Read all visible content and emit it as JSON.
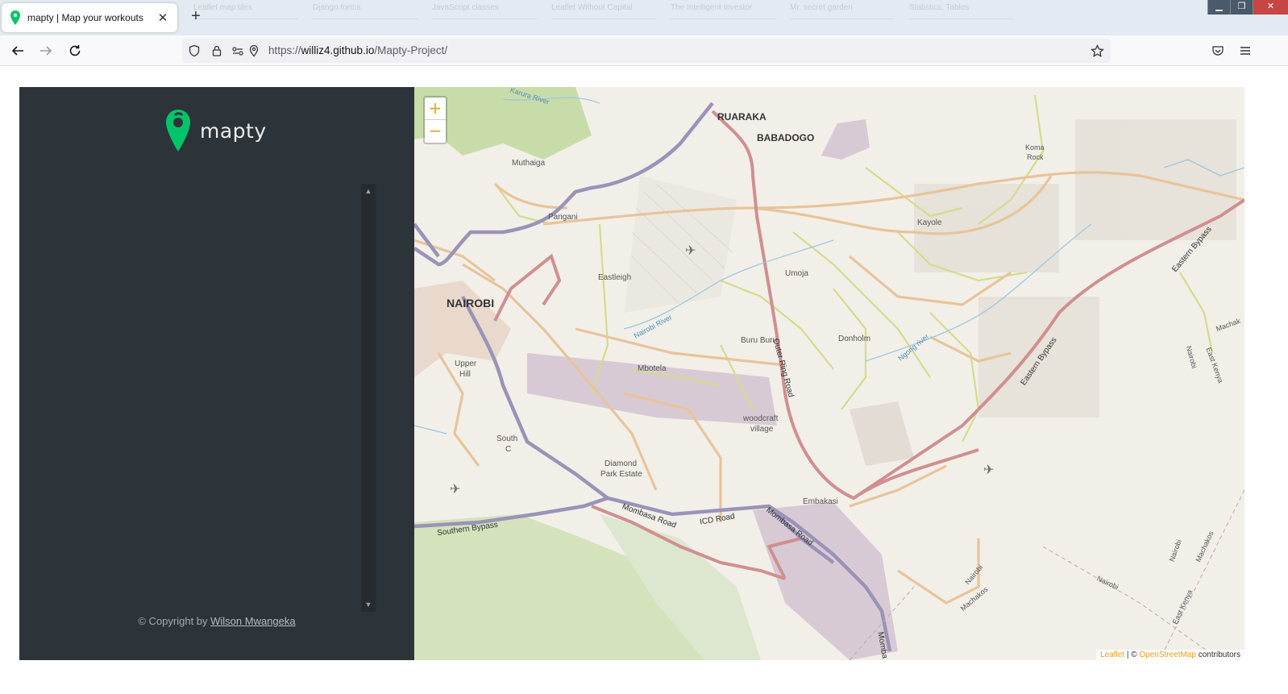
{
  "browser": {
    "tab_title": "mapty | Map your workouts",
    "tab_close": "✕",
    "new_tab": "+",
    "url_scheme": "https://",
    "url_host": "williz4.github.io",
    "url_path": "/Mapty-Project/",
    "background_tabs": [
      "Leaflet map tiles",
      "Django forms",
      "JavaScript classes",
      "Leaflet Without Capital",
      "The Intelligent Investor",
      "Mr. secret garden",
      "Statistics, Tables"
    ],
    "window_buttons": {
      "minimize": "▁",
      "restore": "❐",
      "close": "✕"
    }
  },
  "sidebar": {
    "logo_text": "mapty",
    "copyright_prefix": "© Copyright by ",
    "copyright_author": "Wilson Mwangeka",
    "workouts": []
  },
  "map": {
    "zoom_in": "+",
    "zoom_out": "−",
    "attribution_leaflet": "Leaflet",
    "attribution_sep": " | © ",
    "attribution_osm": "OpenStreetMap",
    "attribution_suffix": " contributors",
    "labels": {
      "ruaraka": "RUARAKA",
      "babadogo": "BABADOGO",
      "nairobi": "NAIROBI",
      "muthaiga": "Muthaiga",
      "pangani": "Pangani",
      "eastleigh": "Eastleigh",
      "umoja": "Umoja",
      "kayole": "Kayole",
      "koma_rock_1": "Koma",
      "koma_rock_2": "Rock",
      "upper_hill_1": "Upper",
      "upper_hill_2": "Hill",
      "buru_buru": "Buru Buru",
      "donholm": "Donholm",
      "mbotela": "Mbotela",
      "woodcraft_1": "woodcraft",
      "woodcraft_2": "village",
      "south_c_1": "South",
      "south_c_2": "C",
      "diamond_1": "Diamond",
      "diamond_2": "Park Estate",
      "embakasi": "Embakasi",
      "karura_river": "Karura River",
      "nairobi_river": "Nairobi River",
      "ngong_river": "Ngong river",
      "outer_ring": "Outer Ring Road",
      "eastern_bypass_1": "Eastern Bypass",
      "eastern_bypass_2": "Eastern Bypass",
      "southern_bypass": "Southern Bypass",
      "mombasa_road_1": "Mombasa Road",
      "mombasa_road_2": "Mombasa Road",
      "icd_road": "ICD Road",
      "mombasa_edge": "Momba",
      "machakos": "Machak",
      "nairobi_v": "Nairobi",
      "east_kenya_v": "East Kenya",
      "nairobi_se1": "Nairobi",
      "machakos_se1": "Machakos",
      "nairobi_se2": "Nairobi",
      "nairobi_se3": "Nairobi",
      "machakos_se2": "Machakos",
      "east_kenya_se": "East Kenya"
    }
  },
  "colors": {
    "sidebar_bg": "#2d3439",
    "brand_green": "#00c46a",
    "map_bg": "#f2efe9",
    "primary_road": "#d08f8f",
    "trunk_road": "#9a93b8",
    "secondary_road": "#e8c49a",
    "tertiary_road": "#d4dc8a",
    "park": "#c8dcaa",
    "industrial": "#d8cad4"
  }
}
